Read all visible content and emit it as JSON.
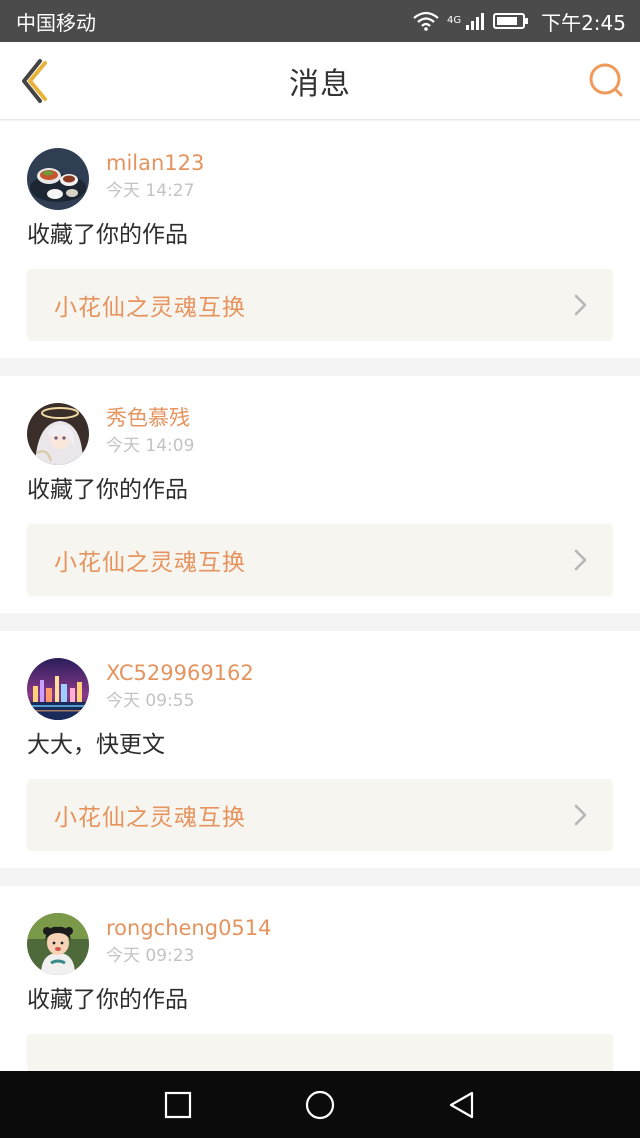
{
  "status_bar": {
    "carrier": "中国移动",
    "network": "4G",
    "time": "下午2:45"
  },
  "header": {
    "title": "消息",
    "back_icon": "chevron-left-icon",
    "search_icon": "search-icon",
    "accent_color": "#e8b33a"
  },
  "messages": [
    {
      "username": "milan123",
      "time": "今天 14:27",
      "text": "收藏了你的作品",
      "work_title": "小花仙之灵魂互换"
    },
    {
      "username": "秀色慕残",
      "time": "今天 14:09",
      "text": "收藏了你的作品",
      "work_title": "小花仙之灵魂互换"
    },
    {
      "username": "XC529969162",
      "time": "今天 09:55",
      "text": "大大，快更文",
      "work_title": "小花仙之灵魂互换"
    },
    {
      "username": "rongcheng0514",
      "time": "今天 09:23",
      "text": "收藏了你的作品",
      "work_title": ""
    }
  ],
  "colors": {
    "username": "#e4945f",
    "link_text": "#e6935e",
    "link_bg": "#f6f5ef"
  },
  "nav_bar": {
    "recent_icon": "square-icon",
    "home_icon": "circle-icon",
    "back_icon": "triangle-back-icon"
  }
}
